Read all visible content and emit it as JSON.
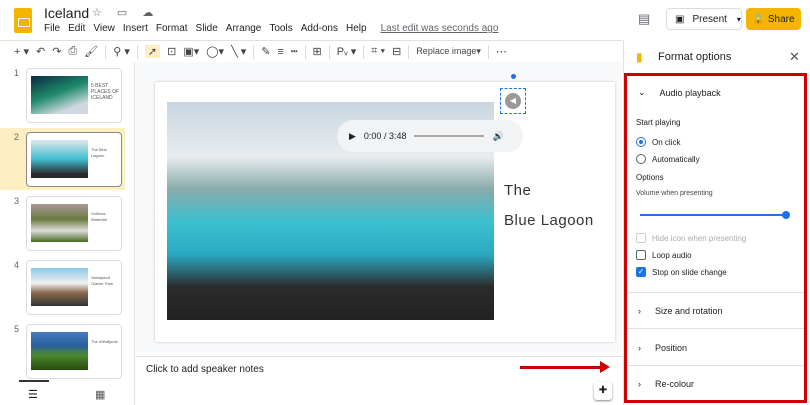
{
  "app": {
    "title": "Iceland",
    "menu": [
      "File",
      "Edit",
      "View",
      "Insert",
      "Format",
      "Slide",
      "Arrange",
      "Tools",
      "Add-ons",
      "Help"
    ],
    "last_edit": "Last edit was seconds ago",
    "present": "Present",
    "share": "Share"
  },
  "toolbar": {
    "replace_image": "Replace image"
  },
  "slides": [
    {
      "num": "1",
      "text": "5 BEST PLACES OF ICELAND"
    },
    {
      "num": "2",
      "text": "The Blue Lagoon"
    },
    {
      "num": "3",
      "text": "Gullfoss Waterfall"
    },
    {
      "num": "4",
      "text": "Vatnajokull Glacier Park"
    },
    {
      "num": "5",
      "text": "The Westfjords"
    }
  ],
  "slide": {
    "line1": "The",
    "line2": "Blue Lagoon",
    "player_time": "0:00 / 3:48"
  },
  "notes": {
    "placeholder": "Click to add speaker notes"
  },
  "panel": {
    "title": "Format options",
    "audio_playback": "Audio playback",
    "start_playing": "Start playing",
    "on_click": "On click",
    "automatically": "Automatically",
    "options": "Options",
    "volume": "Volume when presenting",
    "volume_level": 1.0,
    "hide_icon": "Hide icon when presenting",
    "loop": "Loop audio",
    "stop": "Stop on slide change",
    "size_rotation": "Size and rotation",
    "position": "Position",
    "recolour": "Re-colour"
  },
  "colors": {
    "accent": "#1a73e8",
    "brand": "#f4b400",
    "highlight": "#c00000"
  }
}
